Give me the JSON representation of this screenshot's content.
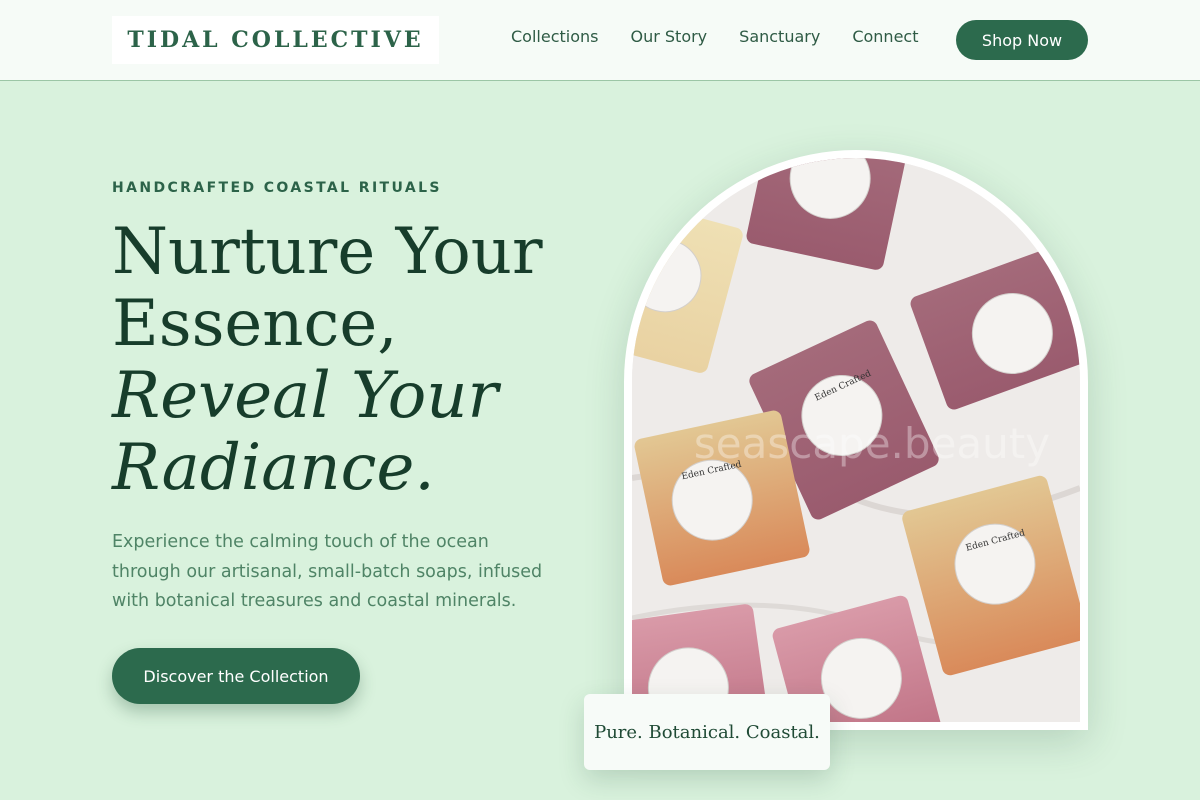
{
  "header": {
    "logo_text": "TIDAL COLLECTIVE",
    "nav": [
      {
        "label": "Collections"
      },
      {
        "label": "Our Story"
      },
      {
        "label": "Sanctuary"
      },
      {
        "label": "Connect"
      }
    ],
    "shop_label": "Shop Now"
  },
  "hero": {
    "eyebrow": "HANDCRAFTED COASTAL RITUALS",
    "headline": {
      "line1": "Nurture Your",
      "line2": "Essence,",
      "line3": "Reveal Your",
      "line4": "Radiance."
    },
    "lede": "Experience the calming touch of the ocean through our artisanal, small-batch soaps, infused with botanical treasures and coastal minerals.",
    "cta_label": "Discover the Collection"
  },
  "image": {
    "label_brand": "Eden Crafted",
    "watermark": "seascape.beauty"
  },
  "tagline": "Pure. Botanical. Coastal.",
  "colors": {
    "background": "#d9f2dd",
    "primary": "#2c6a4d",
    "heading": "#173d2b",
    "body_text": "#4f8466",
    "header_bg": "#f6fbf7"
  }
}
